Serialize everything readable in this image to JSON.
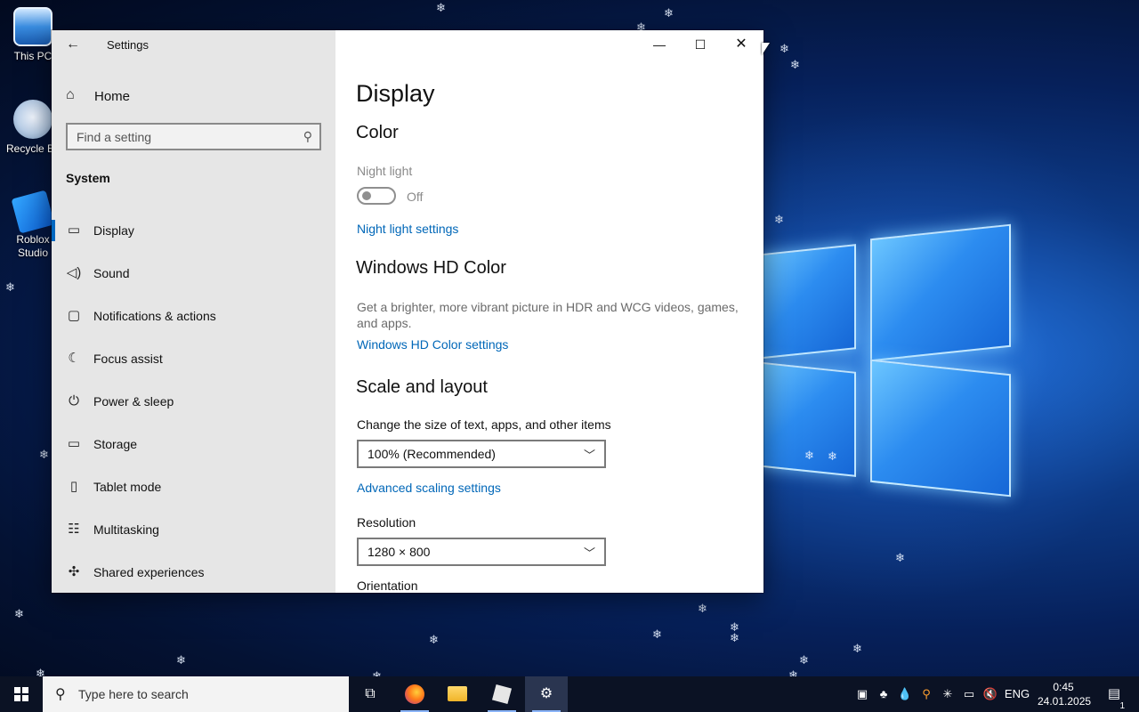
{
  "desktop": {
    "icons": [
      {
        "label": "This PC"
      },
      {
        "label": "Recycle B"
      },
      {
        "label": "Roblox\nStudio"
      }
    ]
  },
  "window": {
    "app_title": "Settings",
    "back_glyph": "←",
    "controls": {
      "minimize": "—",
      "maximize": "☐",
      "close": "✕"
    }
  },
  "sidebar": {
    "home_label": "Home",
    "search_placeholder": "Find a setting",
    "section_label": "System",
    "items": [
      {
        "label": "Display",
        "icon": "monitor-icon",
        "glyph": "▭",
        "active": true
      },
      {
        "label": "Sound",
        "icon": "speaker-icon",
        "glyph": "🔈"
      },
      {
        "label": "Notifications & actions",
        "icon": "notification-icon",
        "glyph": "▢"
      },
      {
        "label": "Focus assist",
        "icon": "moon-icon",
        "glyph": "☾"
      },
      {
        "label": "Power & sleep",
        "icon": "power-icon",
        "glyph": "⏻"
      },
      {
        "label": "Storage",
        "icon": "storage-icon",
        "glyph": "▭"
      },
      {
        "label": "Tablet mode",
        "icon": "tablet-icon",
        "glyph": "▯"
      },
      {
        "label": "Multitasking",
        "icon": "multitasking-icon",
        "glyph": "☷"
      },
      {
        "label": "Shared experiences",
        "icon": "shared-icon",
        "glyph": "✣"
      }
    ]
  },
  "content": {
    "page_title": "Display",
    "color_heading": "Color",
    "night_light_label": "Night light",
    "night_light_state": "Off",
    "night_light_link": "Night light settings",
    "hdr_heading": "Windows HD Color",
    "hdr_description": "Get a brighter, more vibrant picture in HDR and WCG videos, games, and apps.",
    "hdr_link": "Windows HD Color settings",
    "scale_heading": "Scale and layout",
    "scale_label": "Change the size of text, apps, and other items",
    "scale_value": "100% (Recommended)",
    "advanced_scaling_link": "Advanced scaling settings",
    "resolution_label": "Resolution",
    "resolution_value": "1280 × 800",
    "orientation_label": "Orientation"
  },
  "taskbar": {
    "search_placeholder": "Type here to search",
    "apps": [
      "task-view-icon",
      "firefox-icon",
      "file-explorer-icon",
      "roblox-icon",
      "settings-icon"
    ],
    "tray": {
      "language": "ENG",
      "time": "0:45",
      "date": "24.01.2025",
      "notification_count": "1"
    }
  },
  "colors": {
    "accent": "#0067c0",
    "link": "#0067b8",
    "sidebar_bg": "#e6e6e6",
    "taskbar_bg": "#0b1224"
  }
}
